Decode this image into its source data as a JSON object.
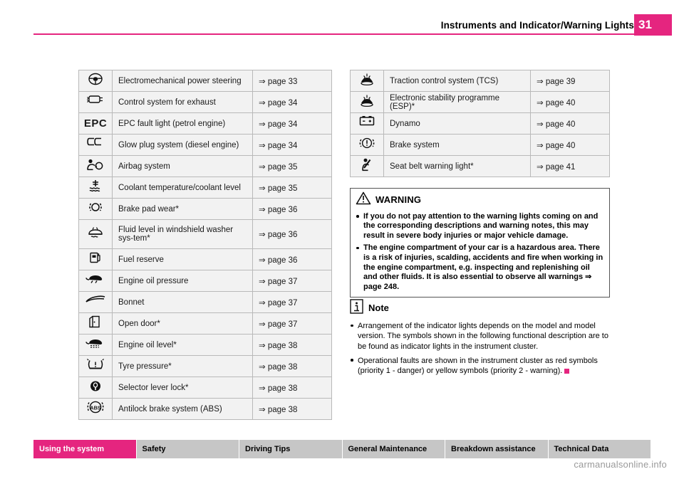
{
  "header": {
    "title": "Instruments and Indicator/Warning Lights",
    "page_number": "31"
  },
  "left_table": [
    {
      "icon": "steering-wheel-icon",
      "label": "Electromechanical power steering",
      "ref": "⇒ page 33"
    },
    {
      "icon": "exhaust-control-icon",
      "label": "Control system for exhaust",
      "ref": "⇒ page 34"
    },
    {
      "icon": "epc-icon",
      "label": "EPC fault light (petrol engine)",
      "ref": "⇒ page 34"
    },
    {
      "icon": "glow-plug-icon",
      "label": "Glow plug system (diesel engine)",
      "ref": "⇒ page 34"
    },
    {
      "icon": "airbag-icon",
      "label": "Airbag system",
      "ref": "⇒ page 35"
    },
    {
      "icon": "coolant-temperature-icon",
      "label": "Coolant temperature/coolant level",
      "ref": "⇒ page 35"
    },
    {
      "icon": "brake-pad-wear-icon",
      "label": "Brake pad wear*",
      "ref": "⇒ page 36"
    },
    {
      "icon": "washer-fluid-icon",
      "label": "Fluid level in windshield washer sys-tem*",
      "ref": "⇒ page 36",
      "tall": true
    },
    {
      "icon": "fuel-reserve-icon",
      "label": "Fuel reserve",
      "ref": "⇒ page 36"
    },
    {
      "icon": "engine-oil-pressure-icon",
      "label": "Engine oil pressure",
      "ref": "⇒ page 37"
    },
    {
      "icon": "bonnet-icon",
      "label": "Bonnet",
      "ref": "⇒ page 37"
    },
    {
      "icon": "open-door-icon",
      "label": "Open door*",
      "ref": "⇒ page 37"
    },
    {
      "icon": "engine-oil-level-icon",
      "label": "Engine oil level*",
      "ref": "⇒ page 38"
    },
    {
      "icon": "tyre-pressure-icon",
      "label": "Tyre pressure*",
      "ref": "⇒ page 38"
    },
    {
      "icon": "selector-lever-lock-icon",
      "label": "Selector lever lock*",
      "ref": "⇒ page 38"
    },
    {
      "icon": "abs-icon",
      "label": "Antilock brake system (ABS)",
      "ref": "⇒ page 38"
    }
  ],
  "right_table": [
    {
      "icon": "traction-control-icon",
      "label": "Traction control system (TCS)",
      "ref": "⇒ page 39"
    },
    {
      "icon": "esp-icon",
      "label": "Electronic stability programme (ESP)*",
      "ref": "⇒ page 40"
    },
    {
      "icon": "dynamo-icon",
      "label": "Dynamo",
      "ref": "⇒ page 40"
    },
    {
      "icon": "brake-system-icon",
      "label": "Brake system",
      "ref": "⇒ page 40"
    },
    {
      "icon": "seat-belt-warning-icon",
      "label": "Seat belt warning light*",
      "ref": "⇒ page 41"
    }
  ],
  "warning": {
    "title": "WARNING",
    "paragraphs": [
      "If you do not pay attention to the warning lights coming on and the corresponding descriptions and warning notes, this may result in severe body injuries or major vehicle damage.",
      "The engine compartment of your car is a hazardous area. There is a risk of injuries, scalding, accidents and fire when working in the engine compartment, e.g. inspecting and replenishing oil and other fluids. It is also essential to observe all warnings ⇒ page 248."
    ]
  },
  "note": {
    "title": "Note",
    "paragraphs": [
      "Arrangement of the indicator lights depends on the model and model version. The symbols shown in the following functional description are to be found as indicator lights in the instrument cluster.",
      "Operational faults are shown in the instrument cluster as red symbols (priority 1 - danger) or yellow symbols (priority 2 - warning)."
    ]
  },
  "footer": {
    "items": [
      {
        "label": "Using the system",
        "active": true
      },
      {
        "label": "Safety",
        "active": false
      },
      {
        "label": "Driving Tips",
        "active": false
      },
      {
        "label": "General Maintenance",
        "active": false
      },
      {
        "label": "Breakdown assistance",
        "active": false
      },
      {
        "label": "Technical Data",
        "active": false
      }
    ],
    "watermark": "carmanualsonline.info"
  },
  "colors": {
    "accent": "#e5257f",
    "table_fill": "#f2f2f2",
    "table_border": "#b9b9b9",
    "footer_fill": "#c6c6c6"
  }
}
